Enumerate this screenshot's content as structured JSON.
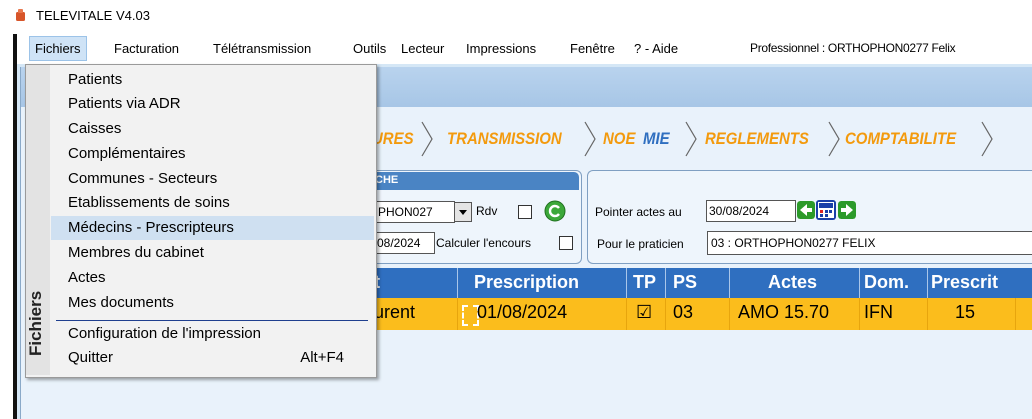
{
  "app": {
    "title": "TELEVITALE V4.03",
    "icon": "app-logo-icon"
  },
  "menubar": {
    "items": [
      "Fichiers",
      "Facturation",
      "Télétransmission",
      "Outils",
      "Lecteur",
      "Impressions",
      "Fenêtre",
      "? - Aide"
    ],
    "active": "Fichiers",
    "professional": "Professionnel : ORTHOPHON0277 Felix"
  },
  "workflow_tabs": [
    "URES",
    "TRANSMISSION",
    "NOEMIE",
    "REGLEMENTS",
    "COMPTABILITE"
  ],
  "colors": {
    "tab_orange": "#f39a0d",
    "tab_blue": "#2f6fc0",
    "row_yellow": "#fbbd1c",
    "header_blue": "#2f6fc0"
  },
  "left_panel": {
    "header": "CHE",
    "practitioner_value": "PHON027",
    "rdv_label": "Rdv",
    "date_value": "08/2024",
    "encours_label": "Calculer l'encours"
  },
  "right_panel": {
    "pointer_label": "Pointer actes au",
    "pointer_date": "30/08/2024",
    "practitioner_label": "Pour le praticien",
    "practitioner_value": "03 : ORTHOPHON0277 FELIX"
  },
  "table": {
    "headers": [
      "t",
      "Prescription",
      "TP",
      "PS",
      "Actes",
      "Dom.",
      "Prescrit"
    ],
    "rows": [
      {
        "patient": "urent",
        "prescription": "01/08/2024",
        "tp": "☑",
        "ps": "03",
        "actes": "AMO 15.70",
        "dom": "IFN",
        "prescrit": "15"
      }
    ]
  },
  "dropdown": {
    "band_label": "Fichiers",
    "items": [
      {
        "label": "Patients"
      },
      {
        "label": "Patients via ADR"
      },
      {
        "label": "Caisses"
      },
      {
        "label": "Complémentaires"
      },
      {
        "label": "Communes - Secteurs"
      },
      {
        "label": "Etablissements de soins"
      },
      {
        "label": "Médecins - Prescripteurs"
      },
      {
        "label": "Membres du cabinet"
      },
      {
        "label": "Actes"
      },
      {
        "label": "Mes documents"
      },
      {
        "label": "Configuration de l'impression"
      },
      {
        "label": "Quitter",
        "shortcut": "Alt+F4"
      }
    ],
    "highlighted": "Médecins - Prescripteurs"
  }
}
